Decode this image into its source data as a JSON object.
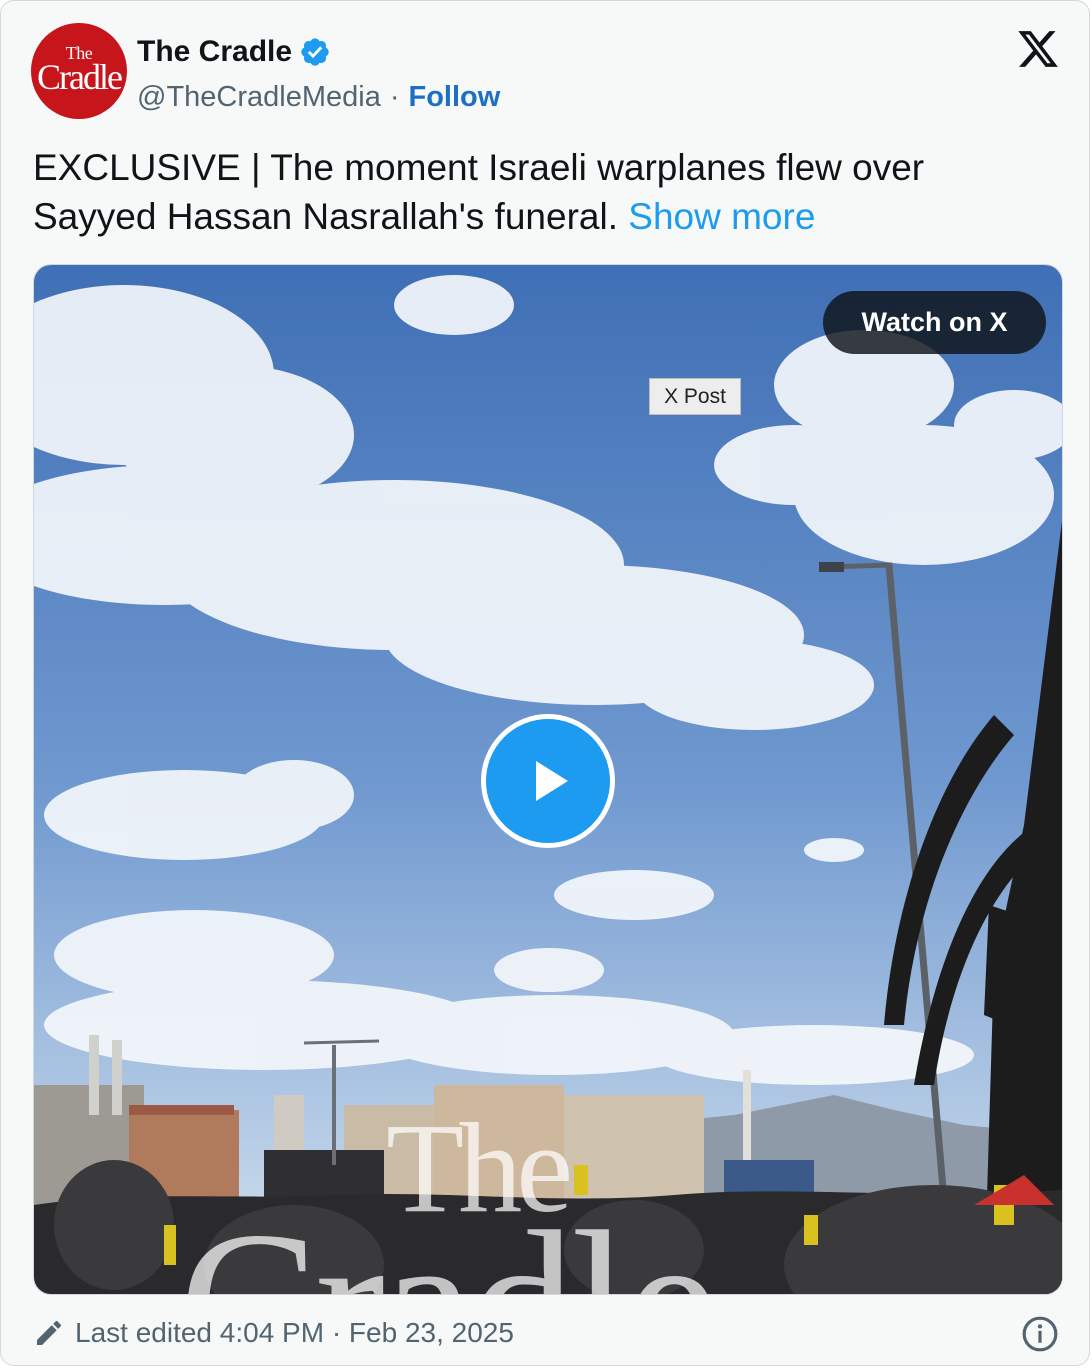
{
  "author": {
    "display_name": "The Cradle",
    "handle": "@TheCradleMedia",
    "follow_label": "Follow",
    "avatar_text_small": "The",
    "avatar_text_large": "Cradle",
    "verified": true
  },
  "separator": "·",
  "tweet": {
    "text": "EXCLUSIVE | The moment Israeli warplanes flew over Sayyed Hassan Nasrallah's funeral.",
    "show_more_label": "Show more"
  },
  "media": {
    "watch_button_label": "Watch on X",
    "tooltip": "X Post",
    "watermark_line1": "The",
    "watermark_line2": "Cradle"
  },
  "footer": {
    "edited_text": "Last edited 4:04 PM · Feb 23, 2025"
  },
  "icons": {
    "platform_logo": "x-logo-icon",
    "verified": "verified-badge-icon",
    "play": "play-icon",
    "edit": "pencil-icon",
    "info": "info-icon"
  },
  "colors": {
    "link_blue": "#1d9bf0",
    "follow_blue": "#1d6fc4",
    "avatar_red": "#c6151b",
    "muted_text": "#536471"
  }
}
